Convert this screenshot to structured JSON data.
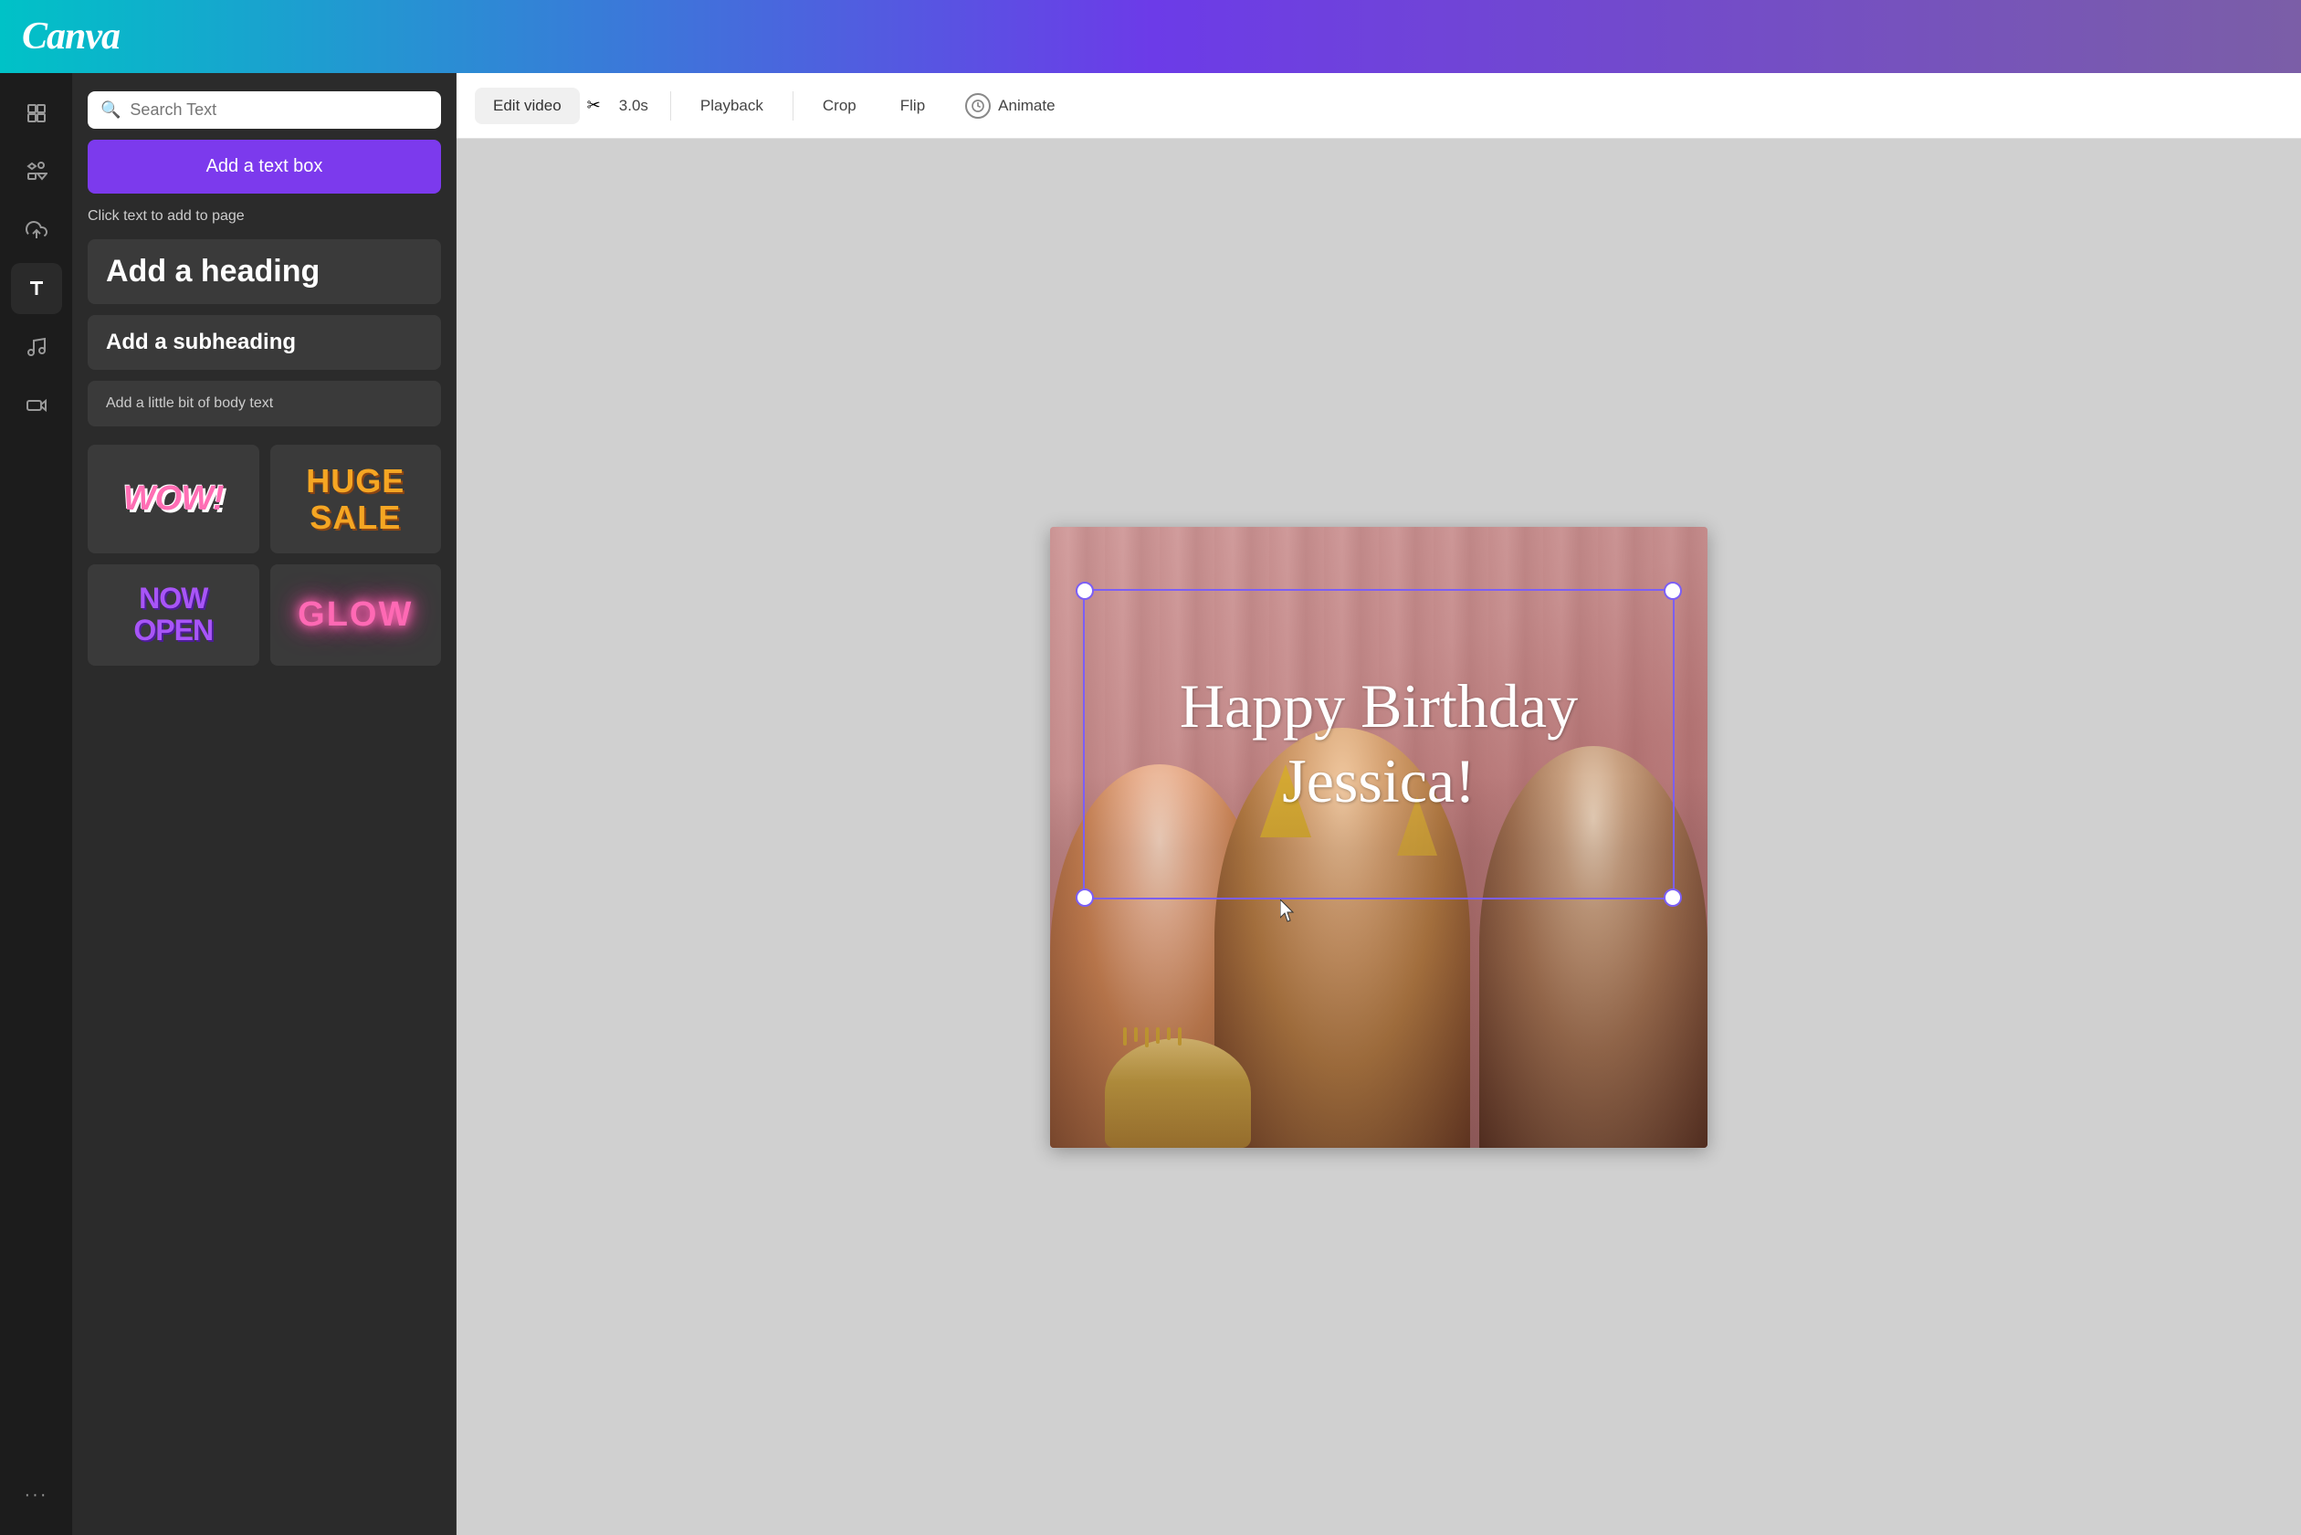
{
  "header": {
    "logo": "Canva"
  },
  "sidebar_icons": [
    {
      "name": "templates-icon",
      "label": "Templates"
    },
    {
      "name": "elements-icon",
      "label": "Elements"
    },
    {
      "name": "uploads-icon",
      "label": "Uploads"
    },
    {
      "name": "text-icon",
      "label": "Text"
    },
    {
      "name": "audio-icon",
      "label": "Audio"
    },
    {
      "name": "video-icon",
      "label": "Video"
    },
    {
      "name": "more-icon",
      "label": "More"
    }
  ],
  "text_panel": {
    "search_placeholder": "Search Text",
    "add_textbox_label": "Add a text box",
    "click_text_label": "Click text to add to page",
    "heading_label": "Add a heading",
    "subheading_label": "Add a subheading",
    "body_label": "Add a little bit of body text",
    "style_cards": [
      {
        "name": "wow",
        "display": "WOW!"
      },
      {
        "name": "huge-sale",
        "display": "HUGE SALE"
      },
      {
        "name": "now-open",
        "display": "NOW OPEN"
      },
      {
        "name": "glow",
        "display": "GLOW"
      }
    ]
  },
  "toolbar": {
    "edit_video_label": "Edit video",
    "duration_label": "3.0s",
    "playback_label": "Playback",
    "crop_label": "Crop",
    "flip_label": "Flip",
    "animate_label": "Animate"
  },
  "canvas": {
    "birthday_text_line1": "Happy Birthday",
    "birthday_text_line2": "Jessica!"
  }
}
